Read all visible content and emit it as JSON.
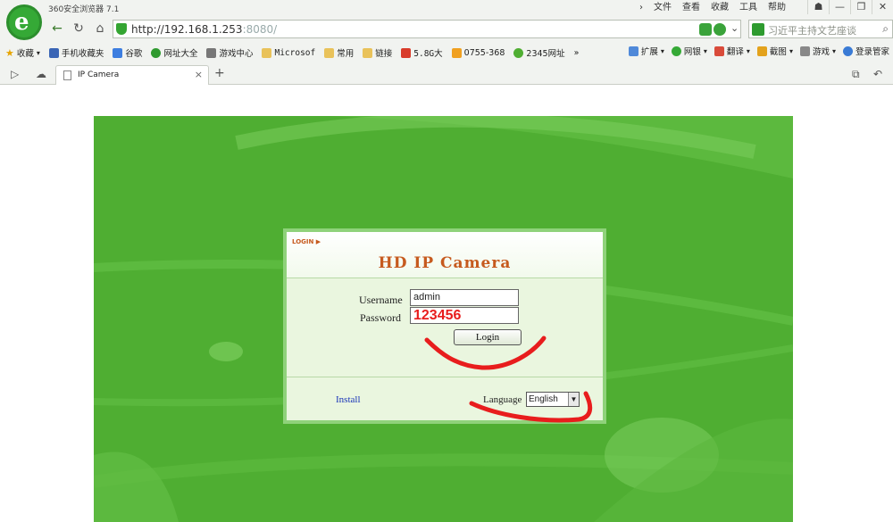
{
  "browser": {
    "app_title": "360安全浏览器 7.1",
    "menu": [
      "文件",
      "查看",
      "收藏",
      "工具",
      "帮助"
    ],
    "url_host": "http://192.168.1.253",
    "url_port": ":8080/",
    "search_placeholder": "习近平主持文艺座谈",
    "bookmarks": [
      "收藏",
      "手机收藏夹",
      "谷歌",
      "网址大全",
      "游戏中心",
      "Microsof",
      "常用",
      "链接",
      "5.8G大",
      "0755-368",
      "2345网址"
    ],
    "bookmarks_right": [
      "扩展",
      "网银",
      "翻译",
      "截图",
      "游戏",
      "登录管家"
    ],
    "tab_title": "IP Camera",
    "new_tab": "+"
  },
  "login": {
    "tag": "LOGIN ▶",
    "title": "HD IP Camera",
    "username_label": "Username",
    "username_value": "admin",
    "password_label": "Password",
    "password_value": "123456",
    "login_button": "Login",
    "install_link": "Install",
    "language_label": "Language",
    "language_value": "English"
  },
  "colors": {
    "stage_green": "#4fae32",
    "title_orange": "#c65a1e",
    "annotation_red": "#e81d1d"
  }
}
